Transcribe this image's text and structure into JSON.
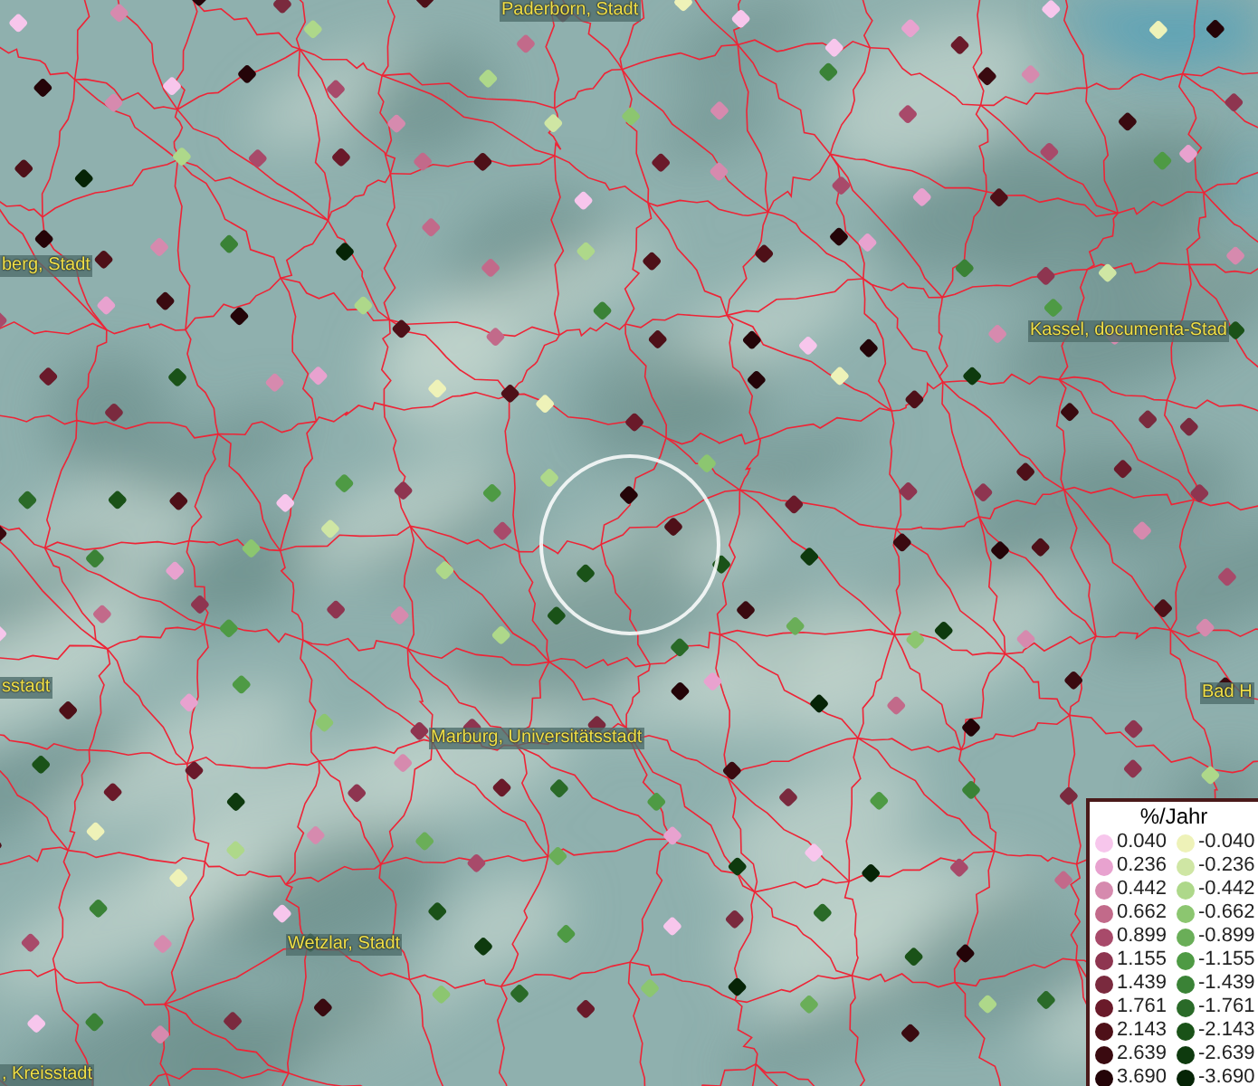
{
  "map": {
    "place_labels": [
      {
        "text": "Paderborn, Stadt"
      },
      {
        "text": "berg, Stadt"
      },
      {
        "text": "Kassel, documenta-Stad"
      },
      {
        "text": "sstadt"
      },
      {
        "text": "Marburg, Universitätsstadt"
      },
      {
        "text": "Bad H"
      },
      {
        "text": "Wetzlar, Stadt"
      },
      {
        "text": ", Kreisstadt"
      }
    ]
  },
  "legend": {
    "title": "%/Jahr",
    "positive": [
      {
        "label": "0.040",
        "color": "#f7c6ec"
      },
      {
        "label": "0.236",
        "color": "#e8a2cf"
      },
      {
        "label": "0.442",
        "color": "#d68aae"
      },
      {
        "label": "0.662",
        "color": "#c26a8a"
      },
      {
        "label": "0.899",
        "color": "#a84a6a"
      },
      {
        "label": "1.155",
        "color": "#8e3550"
      },
      {
        "label": "1.439",
        "color": "#7a2a3e"
      },
      {
        "label": "1.761",
        "color": "#6a1a2a"
      },
      {
        "label": "2.143",
        "color": "#4e1018"
      },
      {
        "label": "2.639",
        "color": "#3a0a10"
      },
      {
        "label": "3.690",
        "color": "#240408"
      }
    ],
    "negative": [
      {
        "label": "-0.040",
        "color": "#eef2b8"
      },
      {
        "label": "-0.236",
        "color": "#cfe6a4"
      },
      {
        "label": "-0.442",
        "color": "#aed88a"
      },
      {
        "label": "-0.662",
        "color": "#8cc670"
      },
      {
        "label": "-0.899",
        "color": "#6aae58"
      },
      {
        "label": "-1.155",
        "color": "#4e9a44"
      },
      {
        "label": "-1.439",
        "color": "#3a8236"
      },
      {
        "label": "-1.761",
        "color": "#2a6a28"
      },
      {
        "label": "-2.143",
        "color": "#1a5218"
      },
      {
        "label": "-2.639",
        "color": "#0e3a0e"
      },
      {
        "label": "-3.690",
        "color": "#062406"
      }
    ]
  }
}
